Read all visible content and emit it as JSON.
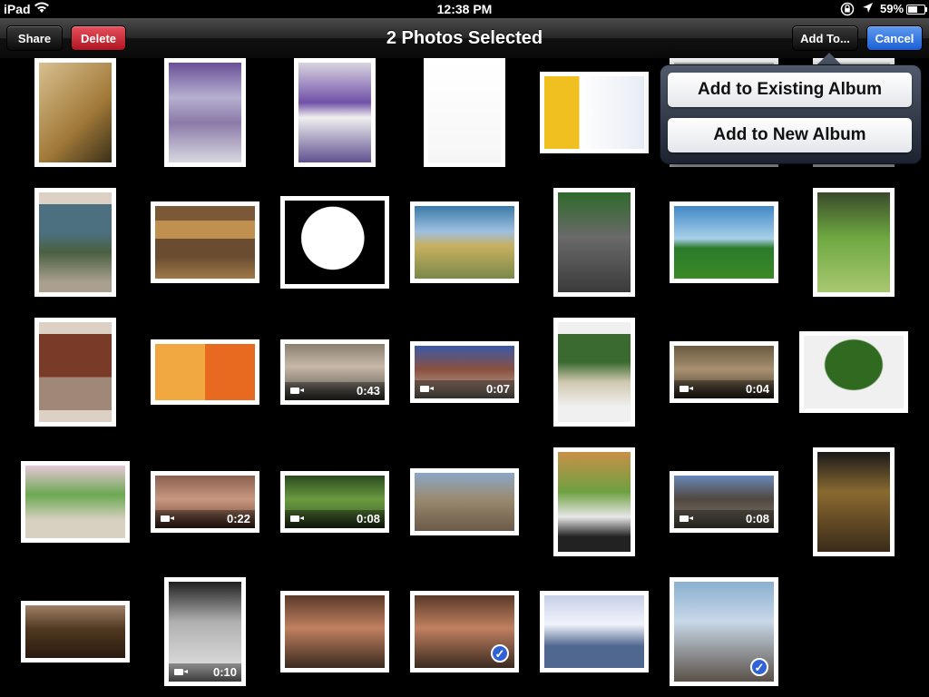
{
  "status": {
    "device": "iPad",
    "time": "12:38 PM",
    "battery": "59%"
  },
  "nav": {
    "title": "2 Photos Selected",
    "share": "Share",
    "delete": "Delete",
    "add_to": "Add To...",
    "cancel": "Cancel"
  },
  "popover": {
    "existing": "Add to Existing Album",
    "new": "Add to New Album"
  },
  "thumbs": [
    {
      "bg": "linear-gradient(135deg,#d8c090,#a07838 60%,#3a3018)"
    },
    {
      "bg": "linear-gradient(#6a5098,#b6b0d0 35%,#8a7aa8 60%,#d8d8e0)"
    },
    {
      "bg": "linear-gradient(#d8d4e0,#7050a8 40%,#f0f0f0 55%,#605090)"
    },
    {
      "bg": "linear-gradient(#ffffff,#f6f6f6)"
    },
    {
      "bg": "linear-gradient(90deg,#f0c020 0 35%,#ffffff 35%,#e8ecf4)"
    },
    {
      "bg": "linear-gradient(#c0c0c0,#909090)"
    },
    {
      "bg": "linear-gradient(#d8d8d8,#a8a8a8)"
    },
    {
      "bg": "linear-gradient(#ddd0c4 0 12%,#4c7080 12% 40%,#4a6040 60%,#aaa090 90%)"
    },
    {
      "bg": "linear-gradient(#7a5838 0 20%,#c09050 20% 45%,#6a4c30 45% 70%,#a07848)"
    },
    {
      "bg": "radial-gradient(circle at 48% 45%,#fff 0 45%,#000 46%)"
    },
    {
      "bg": "linear-gradient(#3a7aa8,#9ec0e0 35%,#c8b060 55%,#7a8848)"
    },
    {
      "bg": "linear-gradient(#2f6a2a,#6a6a6a 45%,#3a3a3a)"
    },
    {
      "bg": "linear-gradient(#4088c8,#a8d0e8 45%,#2a7a2a 58%,#3a8a28)"
    },
    {
      "bg": "linear-gradient(#3a4a2a,#6ea840 45%,#a8c870)"
    },
    {
      "bg": "linear-gradient(#ddd0c4 0 12%,#7a3a28 12% 55%,#a08878 55% 88%,#ddd0c4 88%)"
    },
    {
      "bg": "linear-gradient(90deg,#f2a840 0 50%,#e86a20 50%)"
    },
    {
      "bg": "linear-gradient(#8a8070,#c8b8a8 40%,#505048)",
      "dur": "0:43"
    },
    {
      "bg": "linear-gradient(#3a5aa8,#8a5040 45%,#c0b8a8)",
      "dur": "0:07"
    },
    {
      "bg": "linear-gradient(#f0f0f0 0 12%,#3a6a30 12% 40%,#d0c8b0 60%,#f0f0f0 85%)"
    },
    {
      "bg": "linear-gradient(#6a5a40,#a89070 45%,#403828)",
      "dur": "0:04"
    },
    {
      "bg": "radial-gradient(ellipse at 50% 40%,#2f6a20 0 40%,#f0f0f0 42%)"
    },
    {
      "bg": "linear-gradient(#e8c8d8,#6aa850 40%,#d8d0c0 75%)"
    },
    {
      "bg": "linear-gradient(#8a6050,#c89880 45%,#6a4030)",
      "dur": "0:22"
    },
    {
      "bg": "linear-gradient(#2a4a20,#6a9a40 45%,#3a5a28)",
      "dur": "0:08"
    },
    {
      "bg": "linear-gradient(#8aa8c8,#9a8a70 45%,#6a5a48)"
    },
    {
      "bg": "linear-gradient(#c89048,#6ea040 40%,#e8e8e8 65%,#222 85%)"
    },
    {
      "bg": "linear-gradient(#6a88b8,#504840 45%,#888070)",
      "dur": "0:08"
    },
    {
      "bg": "linear-gradient(#1a1a1a,#8a6a30 40%,#3a2a18)"
    },
    {
      "bg": "linear-gradient(#a08068,#503820 45%,#2a1a10)"
    },
    {
      "bg": "linear-gradient(#202020,#b0b0b0 40%,#e8e8e8)",
      "dur": "0:10"
    },
    {
      "bg": "linear-gradient(#5a3a28,#c08060 45%,#3a2a20)"
    },
    {
      "bg": "linear-gradient(#5a3a28,#c08060 45%,#3a2a20)",
      "selected": true
    },
    {
      "bg": "linear-gradient(#c8d0e8,#f0f4fa 40%,#506890 70%)"
    },
    {
      "bg": "linear-gradient(#8ab0d0,#c8d8e8 40%,#5a5048)",
      "selected": true
    }
  ],
  "colors": {
    "delete": "#c8202c",
    "cancel": "#2a6ee0",
    "check": "#2f62d6",
    "popover": "#2c3446"
  }
}
